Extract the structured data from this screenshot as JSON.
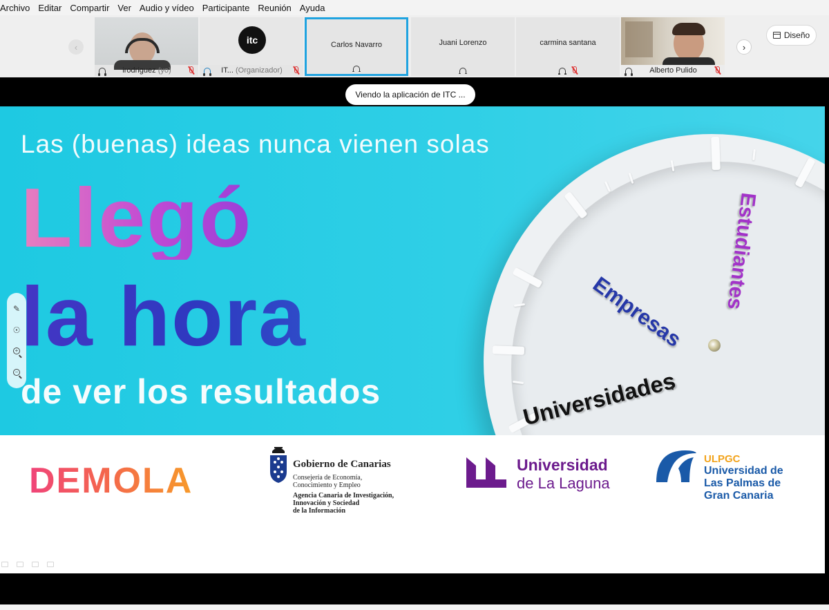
{
  "menu": [
    "Archivo",
    "Editar",
    "Compartir",
    "Ver",
    "Audio y vídeo",
    "Participante",
    "Reunión",
    "Ayuda"
  ],
  "layout_button": "Diseño",
  "participants": [
    {
      "name": "irodriguez",
      "suffix": "(yo)"
    },
    {
      "name": "IT...",
      "suffix": "(Organizador)",
      "logo": "itc"
    },
    {
      "name": "Carlos Navarro"
    },
    {
      "name": "Juani Lorenzo"
    },
    {
      "name": "carmina santana"
    },
    {
      "name": "Alberto Pulido"
    }
  ],
  "share_banner": "Viendo la aplicación de ITC ...",
  "slide": {
    "kicker": "Las (buenas) ideas nunca vienen solas",
    "line1": "Llegó",
    "line2": "la hora",
    "line3": "de ver los resultados",
    "hand_estudiantes": "Estudiantes",
    "hand_empresas": "Empresas",
    "hand_universidades": "Universidades"
  },
  "logos": {
    "demola": "DEMOLA",
    "gobierno_title": "Gobierno de Canarias",
    "gobierno_l1": "Consejería de Economía,",
    "gobierno_l2": "Conocimiento y Empleo",
    "gobierno_l3": "Agencia Canaria de Investigación,",
    "gobierno_l4": "Innovación y Sociedad",
    "gobierno_l5": "de la Información",
    "ull_1": "Universidad",
    "ull_2": "de La Laguna",
    "ulpgc_1": "ULPGC",
    "ulpgc_2": "Universidad de",
    "ulpgc_3": "Las Palmas de",
    "ulpgc_4": "Gran Canaria"
  },
  "colors": {
    "active_tile": "#1fa3e0",
    "slide_bg": "#1ec9e2",
    "mute": "#d33333"
  }
}
